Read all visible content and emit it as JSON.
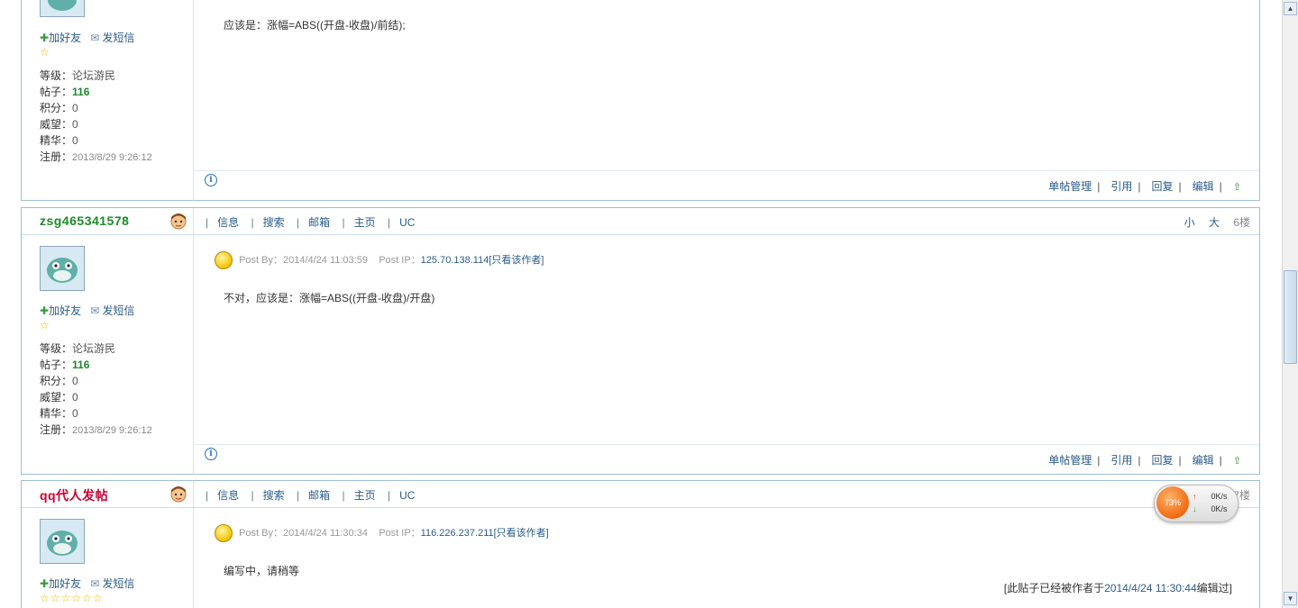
{
  "post_top": {
    "add_friend": "加好友",
    "send_msg": "发短信",
    "stars": "☆",
    "info": {
      "level_k": "等级：",
      "level_v": "论坛游民",
      "posts_k": "帖子：",
      "posts_v": "116",
      "score_k": "积分：",
      "score_v": "0",
      "prestige_k": "威望：",
      "prestige_v": "0",
      "essence_k": "精华：",
      "essence_v": "0",
      "reg_k": "注册：",
      "reg_v": "2013/8/29 9:26:12"
    },
    "content": "应该是：涨幅=ABS((开盘-收盘)/前结);",
    "actions": [
      "单帖管理",
      "引用",
      "回复",
      "编辑"
    ]
  },
  "post_6": {
    "username": "zsg465341578",
    "links": [
      "信息",
      "搜索",
      "邮箱",
      "主页",
      "UC"
    ],
    "size_small": "小",
    "size_big": "大",
    "floor": "6楼",
    "add_friend": "加好友",
    "send_msg": "发短信",
    "stars": "☆",
    "info": {
      "level_k": "等级：",
      "level_v": "论坛游民",
      "posts_k": "帖子：",
      "posts_v": "116",
      "score_k": "积分：",
      "score_v": "0",
      "prestige_k": "威望：",
      "prestige_v": "0",
      "essence_k": "精华：",
      "essence_v": "0",
      "reg_k": "注册：",
      "reg_v": "2013/8/29 9:26:12"
    },
    "post_by_label": "Post By：",
    "post_by_time": "2014/4/24 11:03:59",
    "post_ip_label": "Post IP：",
    "post_ip": "125.70.138.114",
    "only_author": "[只看该作者]",
    "content": "不对，应该是：涨幅=ABS((开盘-收盘)/开盘)",
    "actions": [
      "单帖管理",
      "引用",
      "回复",
      "编辑"
    ]
  },
  "post_7": {
    "username": "qq代人发帖",
    "links": [
      "信息",
      "搜索",
      "邮箱",
      "主页",
      "UC"
    ],
    "floor": "7楼",
    "add_friend": "加好友",
    "send_msg": "发短信",
    "stars": "☆☆☆☆☆☆",
    "post_by_label": "Post By：",
    "post_by_time": "2014/4/24 11:30:34",
    "post_ip_label": "Post IP：",
    "post_ip": "116.226.237.211",
    "only_author": "[只看该作者]",
    "content": "编写中，请稍等",
    "edited_prefix": "[此贴子已经被作者于",
    "edited_time": "2014/4/24 11:30:44",
    "edited_suffix": "编辑过]"
  },
  "net_widget": {
    "percent": "73%",
    "up_speed": "0K/s",
    "down_speed": "0K/s"
  },
  "colors": {
    "border": "#9fbfd9",
    "link": "#2a5c8a",
    "username_green": "#1d8a2a",
    "username_red": "#cc0033"
  }
}
